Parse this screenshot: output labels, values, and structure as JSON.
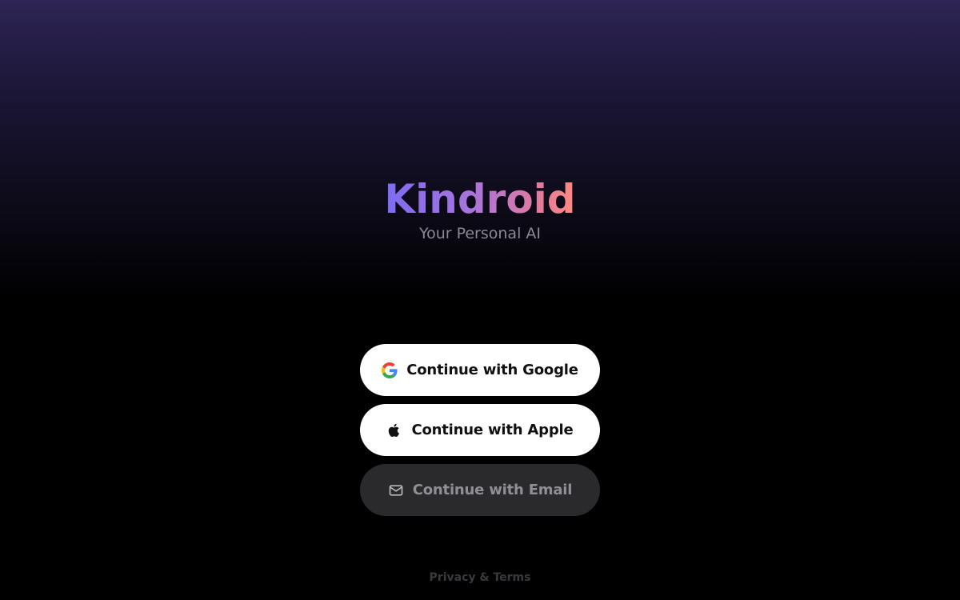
{
  "brand": {
    "logo_text": "Kindroid",
    "tagline": "Your Personal AI"
  },
  "auth": {
    "google_label": "Continue with Google",
    "apple_label": "Continue with Apple",
    "email_label": "Continue with Email"
  },
  "footer": {
    "link_label": "Privacy & Terms"
  },
  "icons": {
    "google": "google-icon",
    "apple": "apple-icon",
    "email": "mail-icon"
  },
  "colors": {
    "background_top": "#2d2454",
    "background_bottom": "#000000",
    "logo_gradient_start": "#7c6cf2",
    "logo_gradient_end": "#ff8a80",
    "button_light": "#ffffff",
    "button_dark": "#2a2a2c"
  }
}
